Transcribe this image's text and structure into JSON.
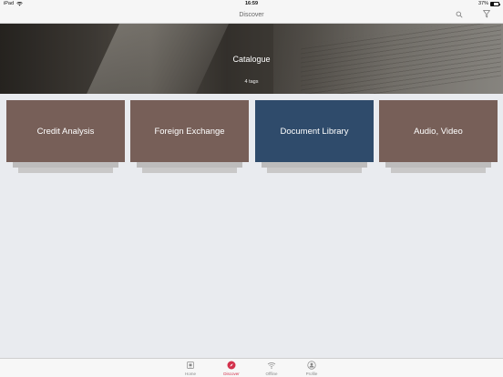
{
  "status_bar": {
    "device": "iPad",
    "time": "16:59",
    "battery": "37%",
    "battery_level": 0.37
  },
  "nav": {
    "title": "Discover",
    "search_icon": "search-icon",
    "filter_icon": "filter-icon"
  },
  "hero": {
    "title": "Catalogue",
    "subtitle": "4 tags"
  },
  "cards": [
    {
      "label": "Credit Analysis",
      "color": "#775f58"
    },
    {
      "label": "Foreign Exchange",
      "color": "#775f58"
    },
    {
      "label": "Document Library",
      "color": "#2f4b6b"
    },
    {
      "label": "Audio, Video",
      "color": "#775f58"
    }
  ],
  "tabs": [
    {
      "label": "Home",
      "icon": "home-icon"
    },
    {
      "label": "Discover",
      "icon": "compass-icon",
      "active": true
    },
    {
      "label": "Offline",
      "icon": "wifi-icon"
    },
    {
      "label": "Profile",
      "icon": "profile-icon"
    }
  ],
  "colors": {
    "accent": "#d3314c",
    "card_brown": "#775f58",
    "card_blue": "#2f4b6b",
    "background": "#e9ebef"
  }
}
